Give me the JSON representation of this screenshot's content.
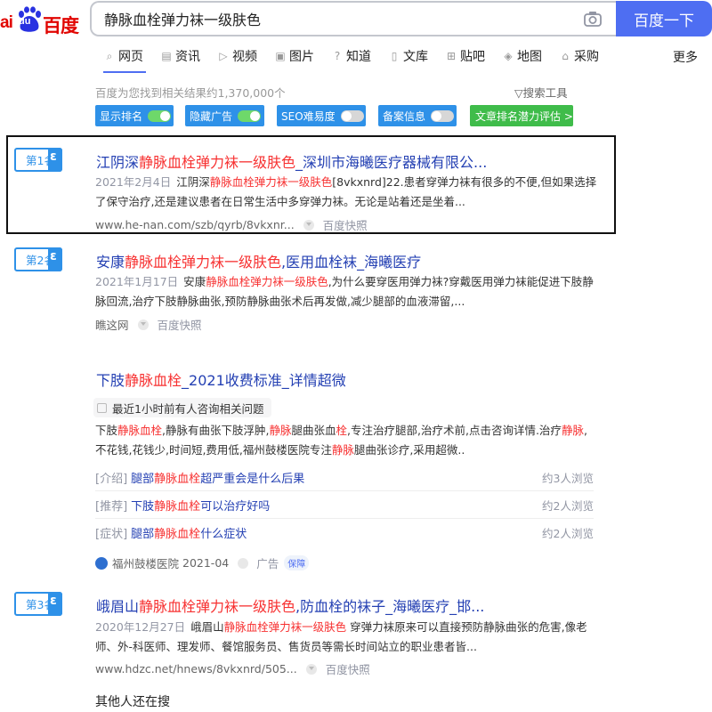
{
  "header": {
    "logo_prefix": "ai",
    "logo_du": "du",
    "logo_cn": "百度",
    "search_value": "静脉血栓弹力袜一级肤色",
    "search_button": "百度一下"
  },
  "tabs": [
    {
      "label": "网页",
      "icon": "search-icon"
    },
    {
      "label": "资讯",
      "icon": "news-icon"
    },
    {
      "label": "视频",
      "icon": "video-icon"
    },
    {
      "label": "图片",
      "icon": "image-icon"
    },
    {
      "label": "知道",
      "icon": "question-icon"
    },
    {
      "label": "文库",
      "icon": "doc-icon"
    },
    {
      "label": "贴吧",
      "icon": "tieba-icon"
    },
    {
      "label": "地图",
      "icon": "map-icon"
    },
    {
      "label": "采购",
      "icon": "bag-icon"
    }
  ],
  "tab_more": "更多",
  "result_count": "百度为您找到相关结果约1,370,000个",
  "search_tools": "搜索工具",
  "plugins": [
    {
      "label": "显示排名",
      "state": "on"
    },
    {
      "label": "隐藏广告",
      "state": "on"
    },
    {
      "label": "SEO难易度",
      "state": "off"
    },
    {
      "label": "备案信息",
      "state": "off"
    },
    {
      "label": "文章排名潜力评估 >",
      "state": "none"
    }
  ],
  "results": [
    {
      "rank": "第1名",
      "title_a": "江阴深",
      "title_b": "静脉血栓弹力袜一级肤色",
      "title_c": "_深圳市海曦医疗器械有限公...",
      "date": "2021年2月4日",
      "abs_a": "江阴深",
      "abs_b": "静脉血栓弹力袜一级肤色",
      "abs_c": "[8vkxnrd]22.患者穿弹力袜有很多的不便,但如果选择了保守治疗,还是建议患者在日常生活中多穿弹力袜。无论是站着还是坐着...",
      "url": "www.he-nan.com/szb/qyrb/8vkxnr...",
      "snapshot": "百度快照"
    },
    {
      "rank": "第2名",
      "title_a": "安康",
      "title_b": "静脉血栓弹力袜一级肤色",
      "title_c": ",医用血栓袜_海曦医疗",
      "date": "2021年1月17日",
      "abs_a": "安康",
      "abs_b": "静脉血栓弹力袜一级肤色",
      "abs_c": ",为什么要穿医用弹力袜?穿戴医用弹力袜能促进下肢静脉回流,治疗下肢静脉曲张,预防静脉曲张术后再发做,减少腿部的血液滞留,...",
      "url": "瞧这网",
      "snapshot": "百度快照"
    },
    {
      "rank": "第3名",
      "title_a": "峨眉山",
      "title_b": "静脉血栓弹力袜一级肤色",
      "title_c": ",防血栓的袜子_海曦医疗_邯...",
      "date": "2020年12月27日",
      "abs_a": "峨眉山",
      "abs_b": "静脉血栓弹力袜一级肤色",
      "abs_c": " 穿弹力袜原来可以直接预防静脉曲张的危害,像老师、外-科医师、理发师、餐馆服务员、售货员等需长时间站立的职业患者皆...",
      "url": "www.hdzc.net/hnews/8vkxnrd/505...",
      "snapshot": "百度快照"
    }
  ],
  "ad": {
    "title_a": "下肢",
    "title_b": "静脉血栓",
    "title_c": "_2021收费标准_详情超微",
    "consult": "最近1小时前有人咨询相关问题",
    "abs_1": "下肢",
    "abs_2": "静脉血栓",
    "abs_3": ",静脉有曲张下肢浮肿,",
    "abs_4": "静脉",
    "abs_5": "腿曲张血",
    "abs_6": "栓",
    "abs_7": ",专注治疗腿部,治疗术前,点击咨询详情.治疗",
    "abs_8": "静脉",
    "abs_9": ",不花钱,花钱少,时间短,费用低,福州鼓楼医院专注",
    "abs_10": "静脉",
    "abs_11": "腿曲张诊疗,采用超微..",
    "links": [
      {
        "tag": "[介绍]",
        "pre": "腿部",
        "em": "静脉血栓",
        "post": "超严重会是什么后果",
        "views": "约3人浏览"
      },
      {
        "tag": "[推荐]",
        "pre": "下肢",
        "em": "静脉血栓",
        "post": "可以治疗好吗",
        "views": "约2人浏览"
      },
      {
        "tag": "[症状]",
        "pre": "腿部",
        "em": "静脉血栓",
        "post": "什么症状",
        "views": "约2人浏览"
      }
    ],
    "source": "福州鼓楼医院",
    "source_date": "2021-04",
    "ad_label": "广告",
    "guarantee": "保障"
  },
  "others_search": "其他人还在搜"
}
